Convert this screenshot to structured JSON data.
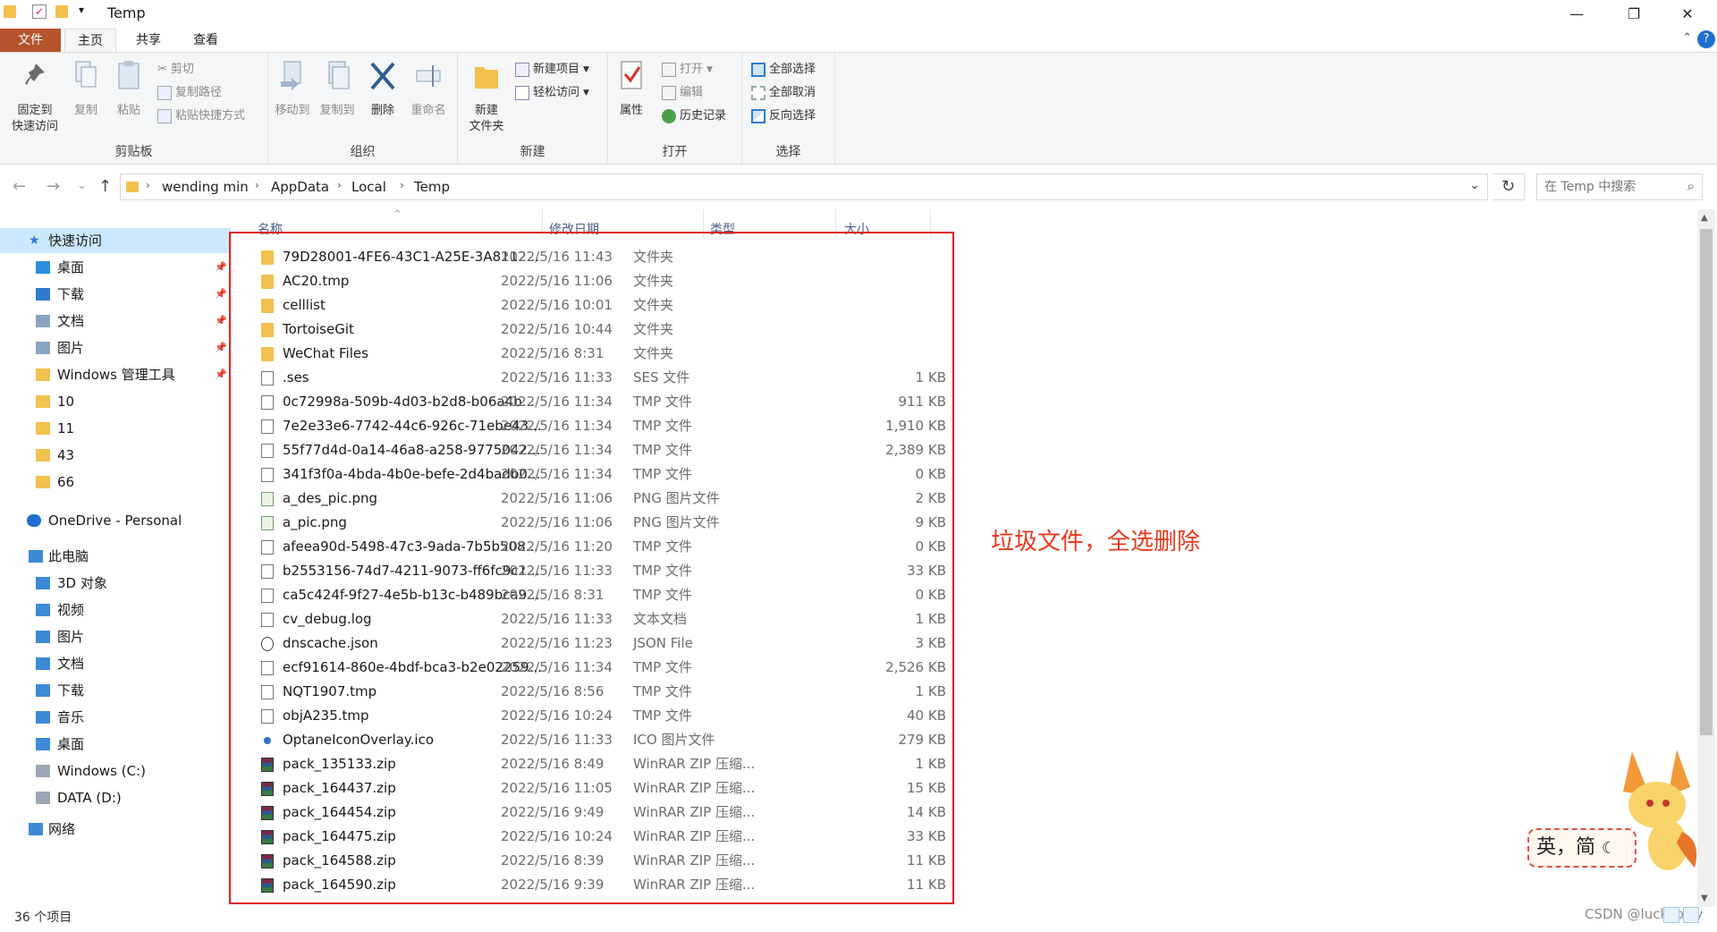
{
  "window": {
    "title": "Temp",
    "controls": {
      "minimize": "—",
      "maximize": "❐",
      "close": "✕"
    },
    "qat_dropdown": "▾"
  },
  "ribbon_tabs": [
    {
      "label": "文件"
    },
    {
      "label": "主页"
    },
    {
      "label": "共享"
    },
    {
      "label": "查看"
    }
  ],
  "ribbon": {
    "clipboard": {
      "label": "剪贴板",
      "pin": "固定到\n快速访问",
      "pin_l1": "固定到",
      "pin_l2": "快速访问",
      "copy": "复制",
      "paste": "粘贴",
      "cut": "剪切",
      "copy_path": "复制路径",
      "paste_shortcut": "粘贴快捷方式"
    },
    "organize": {
      "label": "组织",
      "move_to": "移动到",
      "copy_to": "复制到",
      "delete": "删除",
      "rename": "重命名"
    },
    "new": {
      "label": "新建",
      "new_folder_l1": "新建",
      "new_folder_l2": "文件夹",
      "new_item": "新建项目",
      "easy_access": "轻松访问"
    },
    "open": {
      "label": "打开",
      "properties": "属性",
      "open": "打开",
      "edit": "编辑",
      "history": "历史记录"
    },
    "select": {
      "label": "选择",
      "select_all": "全部选择",
      "select_none": "全部取消",
      "invert": "反向选择"
    }
  },
  "navigation": {
    "back": "←",
    "forward": "→",
    "recent": "⌄",
    "up": "↑",
    "breadcrumbs": [
      "wending min",
      "AppData",
      "Local",
      "Temp"
    ],
    "refresh": "↻",
    "search_placeholder": "在 Temp 中搜索"
  },
  "sidebar": {
    "quick_access": "快速访问",
    "quick_items": [
      "桌面",
      "下载",
      "文档",
      "图片",
      "Windows 管理工具",
      "10",
      "11",
      "43",
      "66"
    ],
    "onedrive": "OneDrive - Personal",
    "this_pc": "此电脑",
    "pc_items": [
      "3D 对象",
      "视频",
      "图片",
      "文档",
      "下载",
      "音乐",
      "桌面",
      "Windows (C:)",
      "DATA (D:)"
    ],
    "network": "网络"
  },
  "columns": {
    "name": "名称",
    "date": "修改日期",
    "type": "类型",
    "size": "大小"
  },
  "files": [
    {
      "name": "79D28001-4FE6-43C1-A25E-3A8112...",
      "date": "2022/5/16 11:43",
      "type": "文件夹",
      "size": "",
      "icon": "folder"
    },
    {
      "name": "AC20.tmp",
      "date": "2022/5/16 11:06",
      "type": "文件夹",
      "size": "",
      "icon": "folder"
    },
    {
      "name": "celllist",
      "date": "2022/5/16 10:01",
      "type": "文件夹",
      "size": "",
      "icon": "folder"
    },
    {
      "name": "TortoiseGit",
      "date": "2022/5/16 10:44",
      "type": "文件夹",
      "size": "",
      "icon": "folder"
    },
    {
      "name": "WeChat Files",
      "date": "2022/5/16 8:31",
      "type": "文件夹",
      "size": "",
      "icon": "folder"
    },
    {
      "name": ".ses",
      "date": "2022/5/16 11:33",
      "type": "SES 文件",
      "size": "1 KB",
      "icon": "file"
    },
    {
      "name": "0c72998a-509b-4d03-b2d8-b06a4b...",
      "date": "2022/5/16 11:34",
      "type": "TMP 文件",
      "size": "911 KB",
      "icon": "file"
    },
    {
      "name": "7e2e33e6-7742-44c6-926c-71ebe43...",
      "date": "2022/5/16 11:34",
      "type": "TMP 文件",
      "size": "1,910 KB",
      "icon": "file"
    },
    {
      "name": "55f77d4d-0a14-46a8-a258-9775042...",
      "date": "2022/5/16 11:34",
      "type": "TMP 文件",
      "size": "2,389 KB",
      "icon": "file"
    },
    {
      "name": "341f3f0a-4bda-4b0e-befe-2d4badb0...",
      "date": "2022/5/16 11:34",
      "type": "TMP 文件",
      "size": "0 KB",
      "icon": "file"
    },
    {
      "name": "a_des_pic.png",
      "date": "2022/5/16 11:06",
      "type": "PNG 图片文件",
      "size": "2 KB",
      "icon": "png"
    },
    {
      "name": "a_pic.png",
      "date": "2022/5/16 11:06",
      "type": "PNG 图片文件",
      "size": "9 KB",
      "icon": "png"
    },
    {
      "name": "afeea90d-5498-47c3-9ada-7b5b508...",
      "date": "2022/5/16 11:20",
      "type": "TMP 文件",
      "size": "0 KB",
      "icon": "file"
    },
    {
      "name": "b2553156-74d7-4211-9073-ff6fc9c1...",
      "date": "2022/5/16 11:33",
      "type": "TMP 文件",
      "size": "33 KB",
      "icon": "file"
    },
    {
      "name": "ca5c424f-9f27-4e5b-b13c-b489bca9...",
      "date": "2022/5/16 8:31",
      "type": "TMP 文件",
      "size": "0 KB",
      "icon": "file"
    },
    {
      "name": "cv_debug.log",
      "date": "2022/5/16 11:33",
      "type": "文本文档",
      "size": "1 KB",
      "icon": "file"
    },
    {
      "name": "dnscache.json",
      "date": "2022/5/16 11:23",
      "type": "JSON File",
      "size": "3 KB",
      "icon": "json"
    },
    {
      "name": "ecf91614-860e-4bdf-bca3-b2e02259...",
      "date": "2022/5/16 11:34",
      "type": "TMP 文件",
      "size": "2,526 KB",
      "icon": "file"
    },
    {
      "name": "NQT1907.tmp",
      "date": "2022/5/16 8:56",
      "type": "TMP 文件",
      "size": "1 KB",
      "icon": "file"
    },
    {
      "name": "objA235.tmp",
      "date": "2022/5/16 10:24",
      "type": "TMP 文件",
      "size": "40 KB",
      "icon": "file"
    },
    {
      "name": "OptaneIconOverlay.ico",
      "date": "2022/5/16 11:33",
      "type": "ICO 图片文件",
      "size": "279 KB",
      "icon": "ico"
    },
    {
      "name": "pack_135133.zip",
      "date": "2022/5/16 8:49",
      "type": "WinRAR ZIP 压缩...",
      "size": "1 KB",
      "icon": "zip"
    },
    {
      "name": "pack_164437.zip",
      "date": "2022/5/16 11:05",
      "type": "WinRAR ZIP 压缩...",
      "size": "15 KB",
      "icon": "zip"
    },
    {
      "name": "pack_164454.zip",
      "date": "2022/5/16 9:49",
      "type": "WinRAR ZIP 压缩...",
      "size": "14 KB",
      "icon": "zip"
    },
    {
      "name": "pack_164475.zip",
      "date": "2022/5/16 10:24",
      "type": "WinRAR ZIP 压缩...",
      "size": "33 KB",
      "icon": "zip"
    },
    {
      "name": "pack_164588.zip",
      "date": "2022/5/16 8:39",
      "type": "WinRAR ZIP 压缩...",
      "size": "11 KB",
      "icon": "zip"
    },
    {
      "name": "pack_164590.zip",
      "date": "2022/5/16 9:39",
      "type": "WinRAR ZIP 压缩...",
      "size": "11 KB",
      "icon": "zip"
    }
  ],
  "status": {
    "item_count": "36 个项目"
  },
  "annotation": {
    "text": "垃圾文件，全选删除",
    "color": "#e8391e"
  },
  "ime_indicator": "英，简",
  "watermark": "CSDN @luckybilly",
  "colors": {
    "file_tab": "#b5542c",
    "selection": "#cce8ff",
    "highlight_box": "#e02020"
  }
}
